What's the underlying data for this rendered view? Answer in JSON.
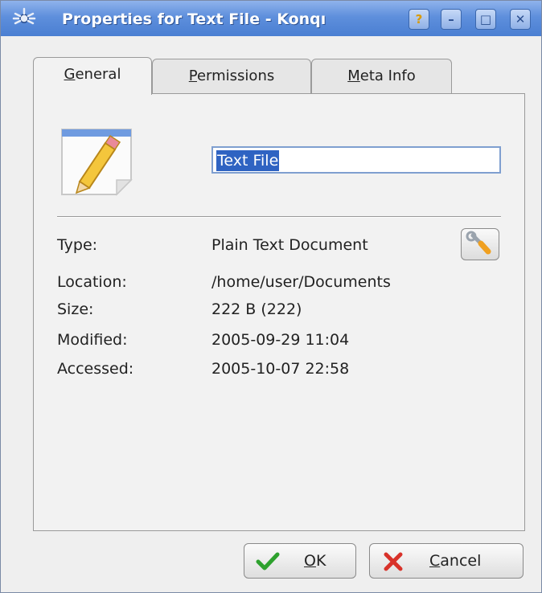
{
  "window": {
    "title": "Properties for Text File - Konqı",
    "buttons": {
      "help": "?",
      "minimize": "–",
      "maximize": "□",
      "close": "✕"
    }
  },
  "tabs": [
    {
      "accel": "G",
      "rest": "eneral",
      "label": "General",
      "active": true
    },
    {
      "accel": "P",
      "rest": "ermissions",
      "label": "Permissions",
      "active": false
    },
    {
      "accel": "M",
      "rest": "eta Info",
      "label": "Meta Info",
      "active": false
    }
  ],
  "general": {
    "icon": "text-file-pencil-icon",
    "name_value": "Text File",
    "fields": [
      {
        "label": "Type:",
        "value": "Plain Text Document"
      },
      {
        "label": "Location:",
        "value": "/home/user/Documents"
      },
      {
        "label": "Size:",
        "value": "222 B (222)"
      },
      {
        "label": "Modified:",
        "value": "2005-09-29 11:04"
      },
      {
        "label": "Accessed:",
        "value": "2005-10-07 22:58"
      }
    ],
    "type_button_icon": "wrench-icon"
  },
  "footer": {
    "ok": {
      "accel": "O",
      "rest": "K",
      "icon": "checkmark-icon"
    },
    "cancel": {
      "accel": "C",
      "rest": "ancel",
      "icon": "red-x-icon"
    }
  },
  "colors": {
    "titlebar": "#5e8fdc",
    "selection": "#2f63c2",
    "ok_green": "#2ea12e",
    "cancel_red": "#d8322a"
  }
}
